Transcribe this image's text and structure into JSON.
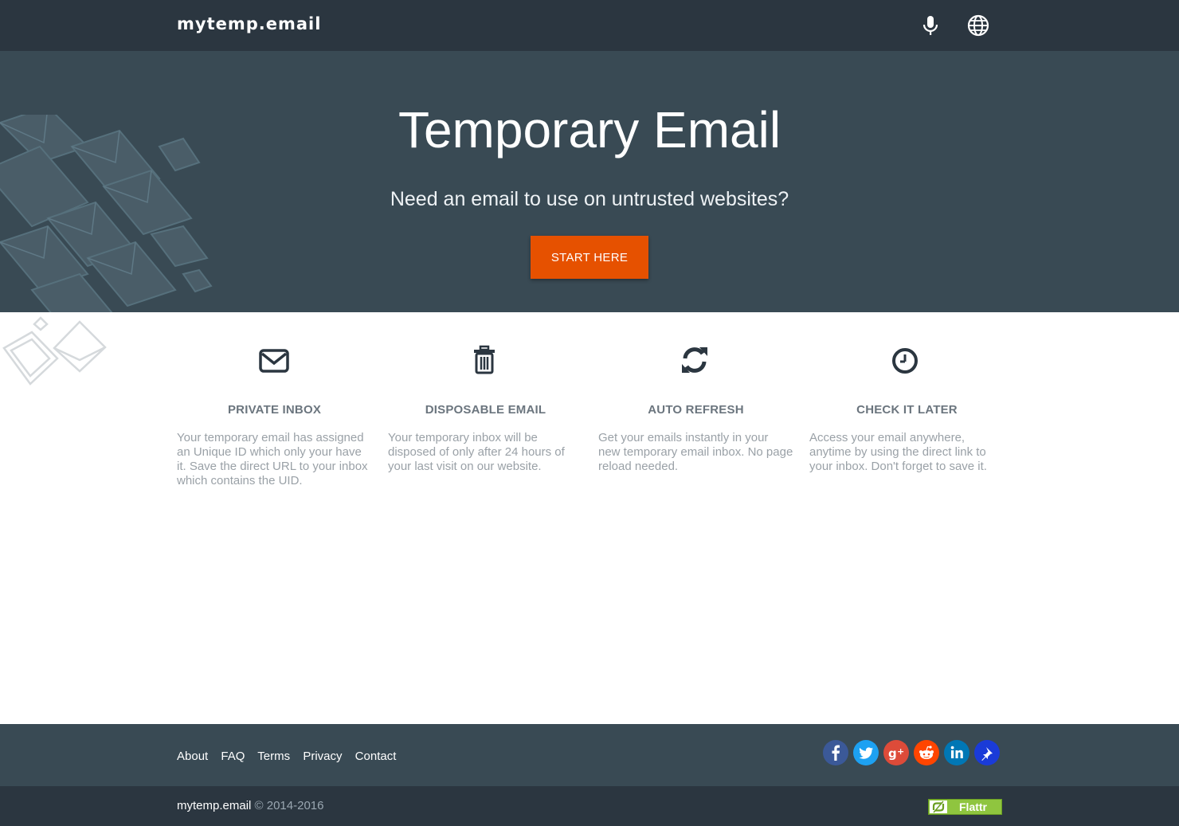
{
  "header": {
    "logo": "mytemp.email",
    "icons": [
      "microphone-icon",
      "globe-icon"
    ]
  },
  "hero": {
    "title": "Temporary Email",
    "subtitle": "Need an email to use on untrusted websites?",
    "button_label": "START HERE"
  },
  "features": [
    {
      "icon": "envelope-icon",
      "title": "PRIVATE INBOX",
      "description": "Your temporary email has assigned an Unique ID which only your have it. Save the direct URL to your inbox which contains the UID."
    },
    {
      "icon": "trash-icon",
      "title": "DISPOSABLE EMAIL",
      "description": "Your temporary inbox will be disposed of only after 24 hours of your last visit on our website."
    },
    {
      "icon": "refresh-icon",
      "title": "AUTO REFRESH",
      "description": "Get your emails instantly in your new temporary email inbox. No page reload needed."
    },
    {
      "icon": "clock-icon",
      "title": "CHECK IT LATER",
      "description": "Access your email anywhere, anytime by using the direct link to your inbox. Don't forget to save it."
    }
  ],
  "footer": {
    "links": [
      "About",
      "FAQ",
      "Terms",
      "Privacy",
      "Contact"
    ],
    "social": [
      {
        "name": "facebook-icon",
        "color": "#3b5998",
        "glyph": "f"
      },
      {
        "name": "twitter-icon",
        "color": "#1da1f2",
        "glyph": ""
      },
      {
        "name": "google-plus-icon",
        "color": "#dd4b39",
        "glyph": "g+"
      },
      {
        "name": "reddit-icon",
        "color": "#ff4500",
        "glyph": ""
      },
      {
        "name": "linkedin-icon",
        "color": "#0077b5",
        "glyph": "in"
      },
      {
        "name": "pinboard-icon",
        "color": "#1a3bd8",
        "glyph": ""
      }
    ]
  },
  "bottom": {
    "site": "mytemp.email",
    "copyright": " © 2014-2016",
    "flattr_label": "Flattr"
  },
  "colors": {
    "topbar": "#2b3640",
    "hero": "#394a54",
    "accent": "#e65100",
    "feature_icon": "#2b3640"
  }
}
